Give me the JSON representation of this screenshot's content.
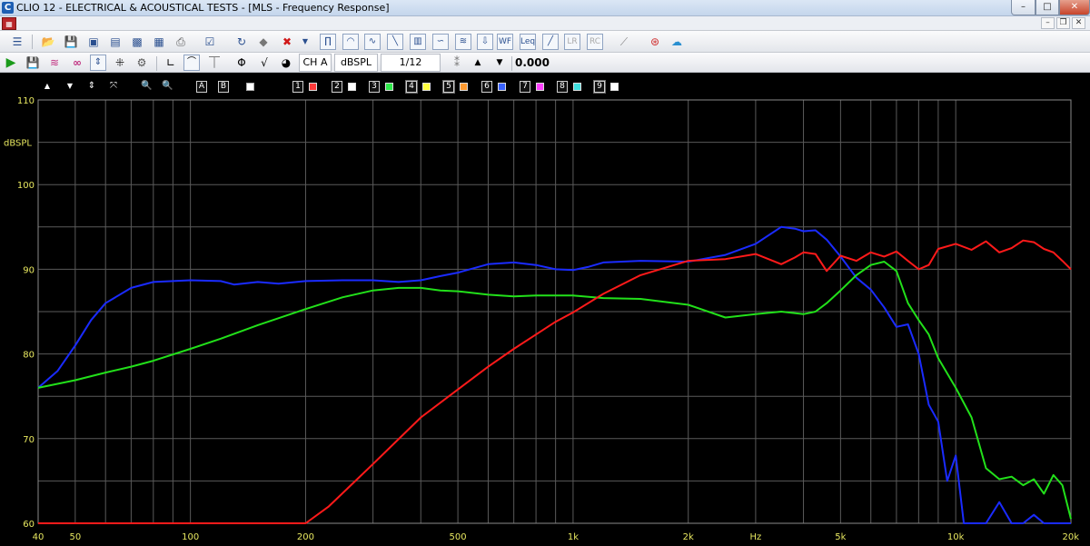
{
  "window": {
    "title": "CLIO 12 - ELECTRICAL & ACOUSTICAL TESTS - [MLS - Frequency Response]",
    "icon_letter": "C",
    "min_glyph": "–",
    "max_glyph": "□",
    "close_glyph": "✕"
  },
  "mdi": {
    "min_glyph": "–",
    "restore_glyph": "❐",
    "close_glyph": "✕"
  },
  "toolbar2": {
    "channel": "CH A",
    "unit": "dBSPL",
    "smoothing": "1/12 Octave",
    "value": "0.000"
  },
  "graph_toolbar": {
    "up": "▲",
    "down": "▼",
    "updown": "⇕",
    "fit": "⤧",
    "zoom_in": "🔍",
    "zoom_out": "🔍",
    "A": "A",
    "B": "B",
    "slots": [
      "1",
      "2",
      "3",
      "4",
      "5",
      "6",
      "7",
      "8",
      "9"
    ],
    "slot_colors": [
      "#ff3b3b",
      "#ffffff",
      "#2ee84a",
      "#ffff40",
      "#ff9a30",
      "#3a63ff",
      "#ff40ff",
      "#40e0e0",
      "#ffffff"
    ]
  },
  "colors": {
    "red": "#ff1a1a",
    "green": "#22e01a",
    "blue": "#1a2bff",
    "grid": "#5a5a5a",
    "axis_text": "#e8e860"
  },
  "chart_data": {
    "type": "line",
    "xlabel": "Hz",
    "ylabel": "dBSPL",
    "x_scale": "log",
    "xlim": [
      40,
      20000
    ],
    "ylim": [
      60,
      110
    ],
    "x_tick_labels": [
      "40",
      "50",
      "100",
      "200",
      "500",
      "1k",
      "2k",
      "Hz",
      "5k",
      "10k",
      "20k"
    ],
    "y_tick_labels": [
      "110",
      "dBSPL",
      "100",
      "90",
      "80",
      "70",
      "60"
    ],
    "grid": true,
    "series": [
      {
        "color": "#1a2bff",
        "x": [
          40,
          45,
          50,
          55,
          60,
          70,
          80,
          90,
          100,
          120,
          130,
          150,
          170,
          200,
          250,
          300,
          350,
          400,
          450,
          500,
          600,
          700,
          800,
          900,
          1000,
          1100,
          1200,
          1500,
          2000,
          2500,
          3000,
          3500,
          3800,
          4000,
          4300,
          4600,
          5000,
          5500,
          6000,
          6500,
          7000,
          7500,
          8000,
          8500,
          9000,
          9500,
          10000,
          10500,
          11000,
          12000,
          13000,
          14000,
          15000,
          16000,
          17000,
          18000,
          19000,
          20000
        ],
        "y": [
          76,
          78,
          81,
          84,
          86,
          87.8,
          88.5,
          88.6,
          88.7,
          88.6,
          88.2,
          88.5,
          88.3,
          88.6,
          88.7,
          88.7,
          88.5,
          88.7,
          89.2,
          89.6,
          90.6,
          90.8,
          90.5,
          90,
          89.9,
          90.3,
          90.8,
          91,
          90.9,
          91.7,
          93,
          95,
          94.8,
          94.5,
          94.6,
          93.5,
          91.5,
          89,
          87.6,
          85.5,
          83.2,
          83.5,
          80,
          74,
          72,
          65,
          68,
          60,
          60,
          60,
          62.5,
          60,
          60,
          61,
          60,
          60,
          60,
          60
        ]
      },
      {
        "color": "#22e01a",
        "x": [
          40,
          50,
          60,
          70,
          80,
          100,
          120,
          150,
          200,
          250,
          300,
          350,
          400,
          450,
          500,
          600,
          700,
          800,
          1000,
          1200,
          1500,
          2000,
          2500,
          3000,
          3500,
          4000,
          4300,
          4600,
          5000,
          5500,
          6000,
          6500,
          7000,
          7500,
          8000,
          8500,
          9000,
          10000,
          11000,
          12000,
          13000,
          14000,
          15000,
          16000,
          17000,
          18000,
          19000,
          20000
        ],
        "y": [
          76,
          76.9,
          77.8,
          78.5,
          79.2,
          80.6,
          81.8,
          83.4,
          85.3,
          86.7,
          87.5,
          87.8,
          87.8,
          87.5,
          87.4,
          87.0,
          86.8,
          86.9,
          86.9,
          86.6,
          86.5,
          85.8,
          84.3,
          84.7,
          85.0,
          84.7,
          85.0,
          86.0,
          87.5,
          89.3,
          90.5,
          90.9,
          89.8,
          86.0,
          84.0,
          82.3,
          79.5,
          76.0,
          72.5,
          66.5,
          65.2,
          65.5,
          64.5,
          65.2,
          63.5,
          65.7,
          64.5,
          60.5
        ]
      },
      {
        "color": "#ff1a1a",
        "x": [
          40,
          100,
          200,
          230,
          300,
          400,
          500,
          600,
          700,
          800,
          900,
          1000,
          1200,
          1500,
          2000,
          2500,
          3000,
          3500,
          3800,
          4000,
          4300,
          4600,
          5000,
          5500,
          6000,
          6500,
          7000,
          7500,
          8000,
          8500,
          9000,
          10000,
          11000,
          12000,
          13000,
          14000,
          15000,
          16000,
          17000,
          18000,
          19000,
          20000
        ],
        "y": [
          60,
          60,
          60,
          62,
          67,
          72.5,
          75.8,
          78.5,
          80.6,
          82.3,
          83.8,
          84.9,
          87.1,
          89.3,
          91.0,
          91.2,
          91.8,
          90.6,
          91.4,
          92.0,
          91.8,
          89.8,
          91.6,
          91.0,
          92.0,
          91.5,
          92.1,
          91.0,
          90.0,
          90.5,
          92.4,
          93.0,
          92.3,
          93.3,
          92.0,
          92.5,
          93.4,
          93.2,
          92.4,
          92.0,
          91.0,
          90.0
        ]
      }
    ]
  }
}
